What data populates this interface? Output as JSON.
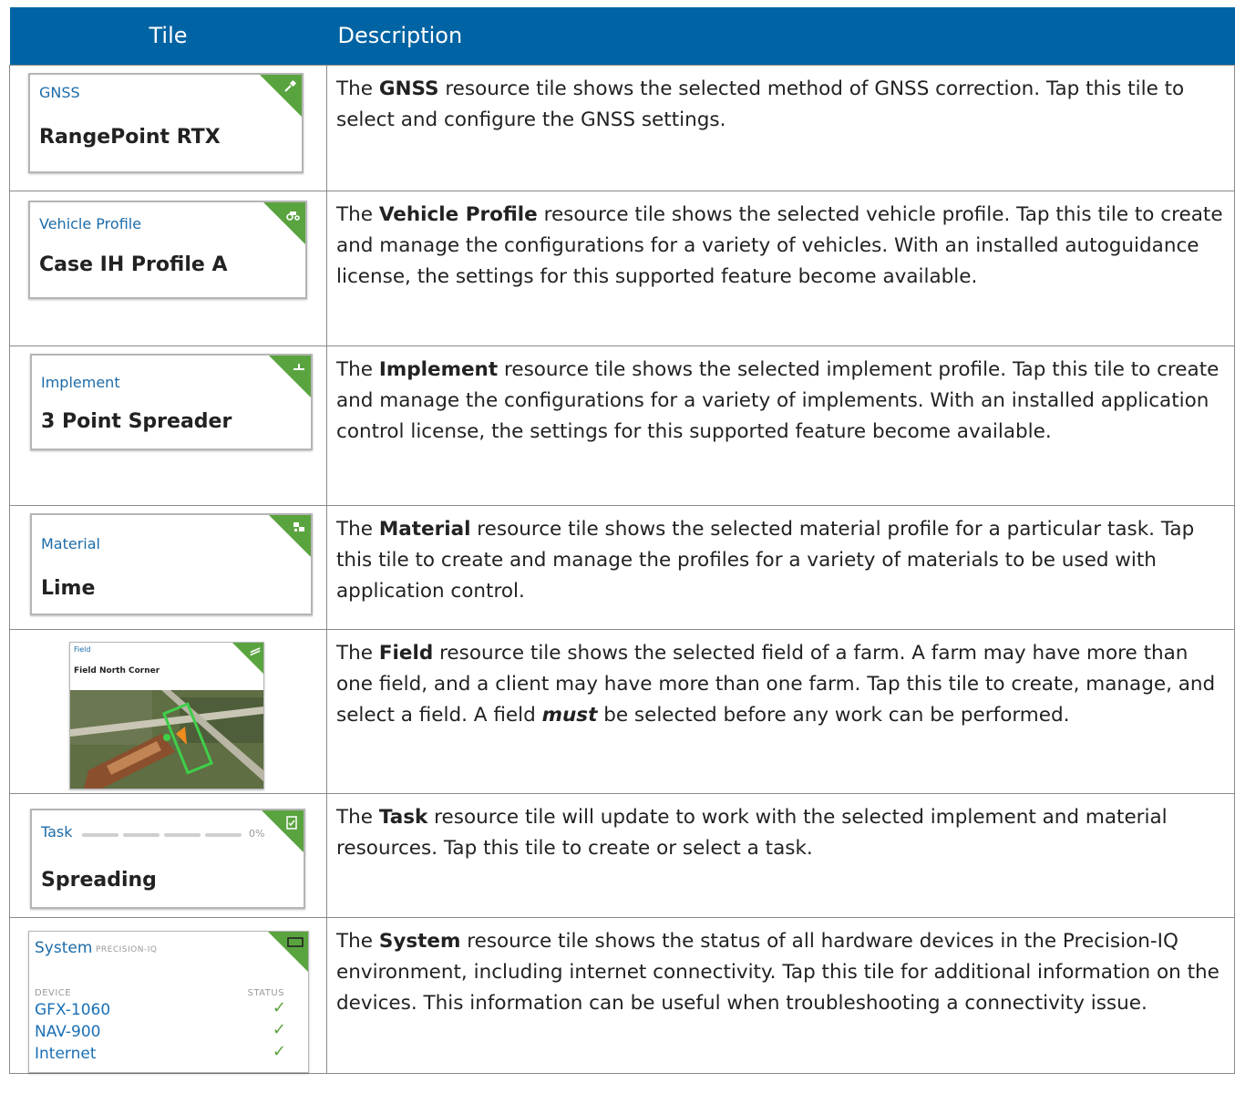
{
  "header": {
    "col_tile": "Tile",
    "col_description": "Description"
  },
  "rows": [
    {
      "tile": {
        "label": "GNSS",
        "value": "RangePoint RTX",
        "icon": "satellite-icon"
      },
      "desc": {
        "pre": "The ",
        "bold": "GNSS",
        "post": " resource tile shows the selected method of GNSS correction. Tap this tile to select and configure the GNSS settings."
      }
    },
    {
      "tile": {
        "label": "Vehicle Profile",
        "value": "Case IH Profile A",
        "icon": "tractor-icon"
      },
      "desc": {
        "pre": "The ",
        "bold": "Vehicle Profile",
        "post": " resource tile shows the selected vehicle profile. Tap this tile to create and manage the configurations for a variety of vehicles. With an installed autoguidance license, the settings for this supported feature become available."
      }
    },
    {
      "tile": {
        "label": "Implement",
        "value": "3 Point Spreader",
        "icon": "implement-icon"
      },
      "desc": {
        "pre": "The ",
        "bold": "Implement",
        "post": " resource tile shows the selected implement profile. Tap this tile to create and manage the configurations for a variety of implements. With an installed application control license, the settings for this supported feature become available."
      }
    },
    {
      "tile": {
        "label": "Material",
        "value": "Lime",
        "icon": "material-icon"
      },
      "desc": {
        "pre": "The ",
        "bold": "Material",
        "post": " resource tile shows the selected material profile for a particular task. Tap this tile to create and manage the profiles for a variety of materials to be used with application control."
      }
    },
    {
      "tile": {
        "label": "Field",
        "value": "Field North Corner",
        "icon": "field-icon"
      },
      "desc": {
        "pre": "The ",
        "bold": "Field",
        "post": " resource tile shows the selected field of a farm. A farm may have more than one field, and a client may have more than one farm. Tap this tile to create, manage, and select a field. A field ",
        "emph": "must",
        "post2": " be selected before any work can be performed."
      }
    },
    {
      "tile": {
        "label": "Task",
        "value": "Spreading",
        "progress": "0%",
        "icon": "clipboard-check-icon"
      },
      "desc": {
        "pre": "The ",
        "bold": "Task",
        "post": " resource tile will update to work with the selected implement and material resources. Tap this tile to create or select a task."
      }
    },
    {
      "tile": {
        "label": "System",
        "sublabel": "PRECISION-IQ",
        "col_device": "DEVICE",
        "col_status": "STATUS",
        "devices": [
          "GFX-1060",
          "NAV-900",
          "Internet"
        ],
        "icon": "display-icon"
      },
      "desc": {
        "pre": "The ",
        "bold": "System",
        "post": " resource tile shows the status of all hardware devices in the Precision-IQ environment, including internet connectivity. Tap this tile for additional information on the devices. This information can be useful when troubleshooting a connectivity issue."
      }
    }
  ],
  "colors": {
    "header_bg": "#0063a3",
    "tile_accent": "#5aa43f",
    "label_blue": "#1d6ca8"
  }
}
